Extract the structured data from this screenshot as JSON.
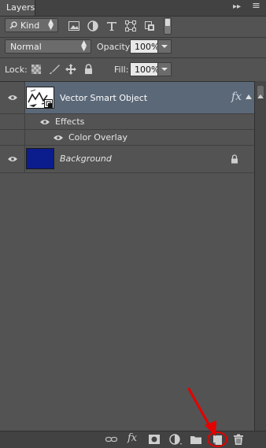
{
  "panel": {
    "tab_label": "Layers",
    "menu_collapse": "▸▸",
    "menu_icon": "≡"
  },
  "filter": {
    "kind_label": "Kind",
    "icons": [
      "pixel-filter-icon",
      "adjustment-filter-icon",
      "type-filter-icon",
      "shape-filter-icon",
      "smart-object-filter-icon",
      "filter-toggle-icon"
    ]
  },
  "blend": {
    "mode": "Normal",
    "opacity_label": "Opacity:",
    "opacity_value": "100%"
  },
  "lock": {
    "label": "Lock:",
    "fill_label": "Fill:",
    "fill_value": "100%"
  },
  "layers": [
    {
      "name": "Vector Smart Object",
      "badge": "fx",
      "selected": true
    },
    {
      "name": "Background",
      "locked": true
    }
  ],
  "effects": {
    "header": "Effects",
    "items": [
      "Color Overlay"
    ]
  },
  "colors": {
    "selected_row": "#5b6878",
    "background_thumb": "#0b1c8c",
    "annotation": "#e50000"
  },
  "footer": {
    "buttons": [
      "link-layers",
      "add-layer-style",
      "add-layer-mask",
      "new-adjustment-layer",
      "new-group",
      "new-layer",
      "delete-layer"
    ],
    "fx_label": "fx"
  }
}
